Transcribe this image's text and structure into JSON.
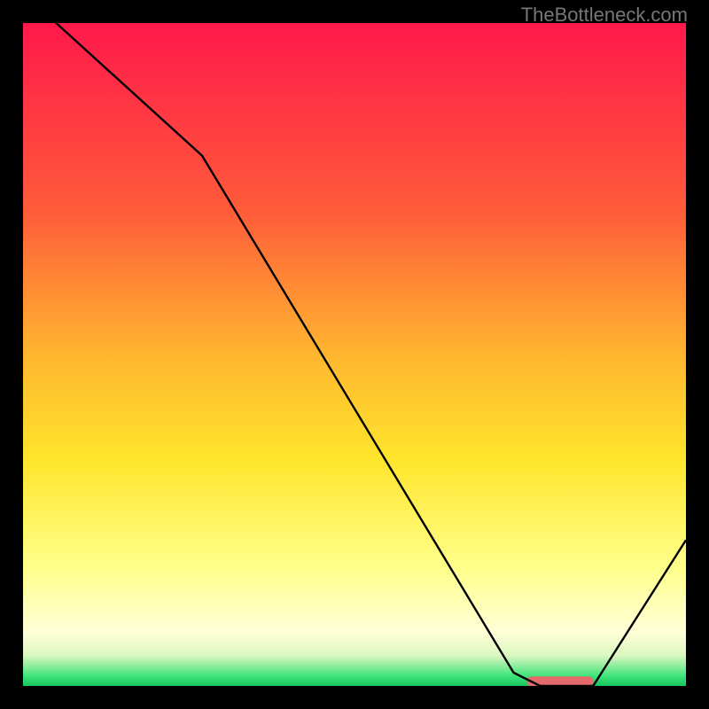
{
  "watermark": "TheBottleneck.com",
  "chart_data": {
    "type": "line",
    "title": "",
    "xlabel": "",
    "ylabel": "",
    "xlim": [
      0,
      100
    ],
    "ylim": [
      0,
      100
    ],
    "x": [
      0,
      5,
      27,
      74,
      78,
      86,
      100
    ],
    "values": [
      104,
      100,
      80,
      2,
      0,
      0,
      22
    ],
    "marker": {
      "x_start": 76,
      "x_end": 86,
      "y": 0.7,
      "color": "#e46a6c"
    },
    "gradient_stops": [
      {
        "offset": 0.0,
        "color": "#ff194b"
      },
      {
        "offset": 0.28,
        "color": "#ff5a3a"
      },
      {
        "offset": 0.5,
        "color": "#ffb62f"
      },
      {
        "offset": 0.66,
        "color": "#ffe52c"
      },
      {
        "offset": 0.82,
        "color": "#ffff8a"
      },
      {
        "offset": 0.92,
        "color": "#ffffd8"
      },
      {
        "offset": 0.955,
        "color": "#d9f7bf"
      },
      {
        "offset": 0.985,
        "color": "#3fe37a"
      },
      {
        "offset": 1.0,
        "color": "#17c55e"
      }
    ]
  }
}
